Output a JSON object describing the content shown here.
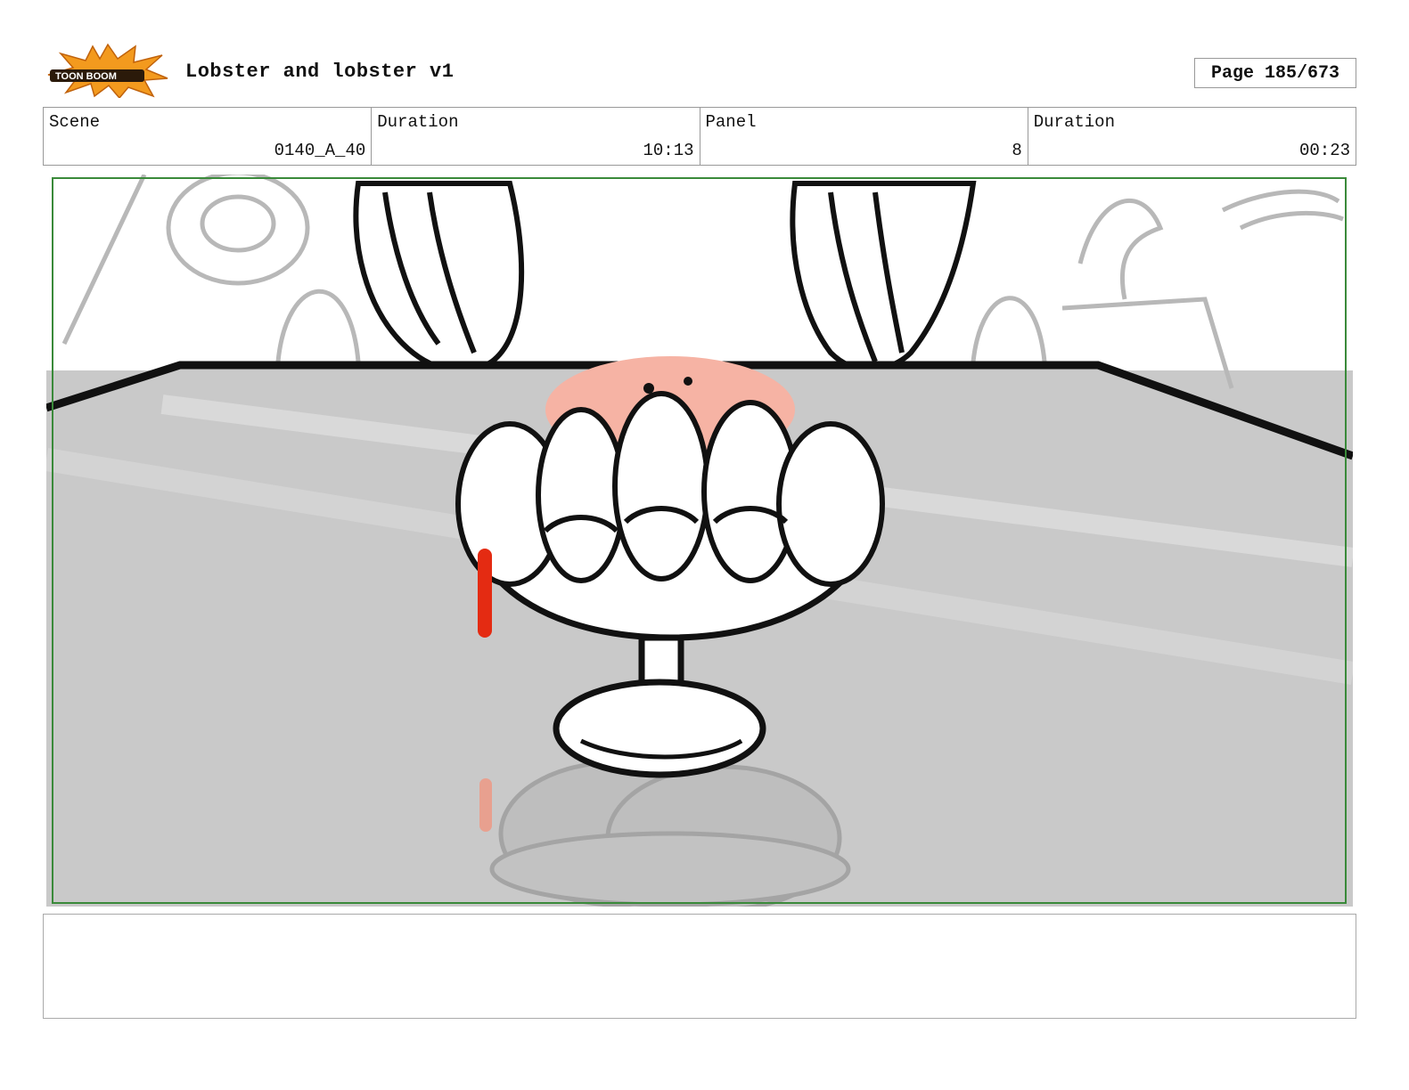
{
  "header": {
    "logo_icon": "toonboom-logo-icon",
    "title": "Lobster and lobster v1",
    "page_label": "Page 185/673"
  },
  "info": {
    "scene_label": "Scene",
    "scene_value": "0140_A_40",
    "scene_duration_label": "Duration",
    "scene_duration_value": "10:13",
    "panel_label": "Panel",
    "panel_value": "8",
    "panel_duration_label": "Duration",
    "panel_duration_value": "00:23"
  },
  "notes": {
    "text": ""
  },
  "colors": {
    "logo_orange": "#f39a1e",
    "frame_green": "#3a8a3a",
    "sauce_red": "#e42b12",
    "shrimp_pink": "#f6b3a4",
    "table_gray": "#c9c9c9"
  }
}
